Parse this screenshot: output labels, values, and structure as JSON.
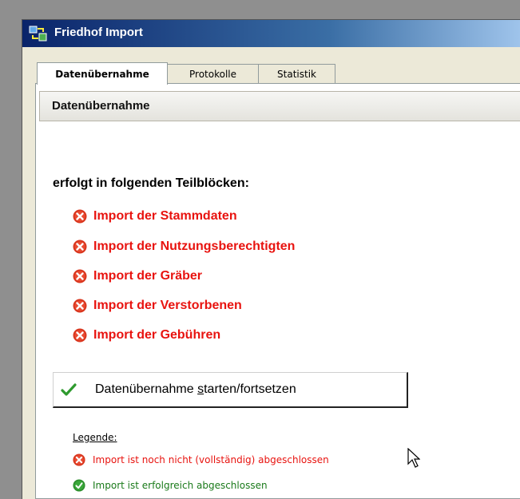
{
  "window": {
    "title": "Friedhof Import",
    "icon": "app-transfer-icon"
  },
  "tabs": [
    {
      "label": "Datenübernahme",
      "active": true
    },
    {
      "label": "Protokolle",
      "active": false
    },
    {
      "label": "Statistik",
      "active": false
    }
  ],
  "panel": {
    "header": "Datenübernahme",
    "intro": "erfolgt in folgenden Teilblöcken:",
    "steps": [
      {
        "label": "Import der Stammdaten",
        "status": "error-icon"
      },
      {
        "label": "Import der Nutzungsberechtigten",
        "status": "error-icon"
      },
      {
        "label": "Import der Gräber",
        "status": "error-icon"
      },
      {
        "label": "Import der Verstorbenen",
        "status": "error-icon"
      },
      {
        "label": "Import der Gebühren",
        "status": "error-icon"
      }
    ],
    "start_button": {
      "label_before": "Datenübernahme ",
      "label_underlined": "s",
      "label_after": "tarten/fortsetzen",
      "icon": "checkmark-icon"
    },
    "legend": {
      "title": "Legende:",
      "items": [
        {
          "label": "Import ist noch nicht (vollständig) abgeschlossen",
          "icon": "error-icon",
          "color": "#e8130f"
        },
        {
          "label": "Import ist erfolgreich abgeschlossen",
          "icon": "success-icon",
          "color": "#1a7a1a"
        }
      ]
    }
  },
  "colors": {
    "error": "#e8130f",
    "success": "#1a7a1a",
    "titlebar": "#0a246a"
  }
}
